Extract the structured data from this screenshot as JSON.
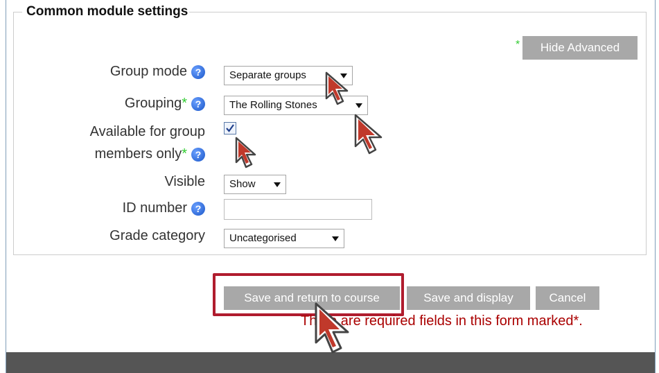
{
  "section": {
    "title": "Common module settings"
  },
  "advanced": {
    "label": "Hide Advanced",
    "marker": "*"
  },
  "fields": {
    "group_mode": {
      "label": "Group mode",
      "value": "Separate groups",
      "help_icon": "help-icon"
    },
    "grouping": {
      "label": "Grouping",
      "required_marker": "*",
      "value": "The Rolling Stones",
      "help_icon": "help-icon"
    },
    "available": {
      "label_line1": "Available for group",
      "label_line2": "members only",
      "required_marker": "*",
      "checked": true
    },
    "visible": {
      "label": "Visible",
      "value": "Show"
    },
    "id_number": {
      "label": "ID number",
      "value": "",
      "help_icon": "help-icon"
    },
    "grade_category": {
      "label": "Grade category",
      "value": "Uncategorised"
    }
  },
  "actions": {
    "save_return": "Save and return to course",
    "save_display": "Save and display",
    "cancel": "Cancel"
  },
  "required_note": "There are required fields in this form marked*.",
  "colors": {
    "button_bg": "#a8a8a8",
    "required_marker": "#33cc33",
    "highlight": "#b01c2e",
    "required_note": "#aa0000",
    "help_icon": "#1a56c8"
  }
}
